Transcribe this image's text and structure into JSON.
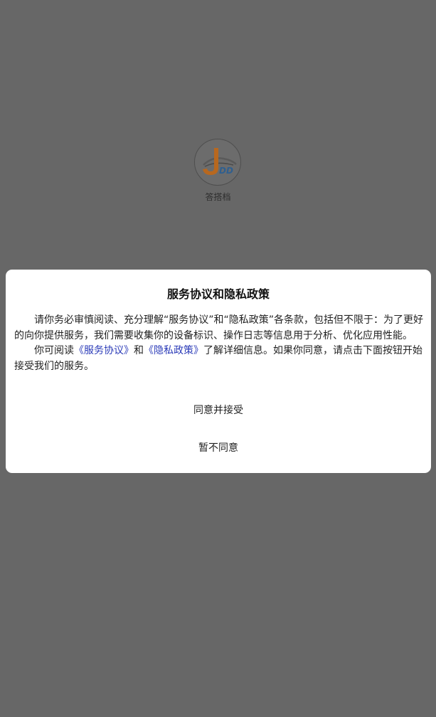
{
  "splash": {
    "app_name": "答搭档",
    "logo_text": "DD"
  },
  "dialog": {
    "title": "服务协议和隐私政策",
    "paragraph1": "请你务必审慎阅读、充分理解“服务协议”和“隐私政策”各条款，包括但不限于：为了更好的向你提供服务，我们需要收集你的设备标识、操作日志等信息用于分析、优化应用性能。",
    "paragraph2_prefix": "你可阅读",
    "terms_link": "《服务协议》",
    "and_text": "和",
    "privacy_link": "《隐私政策》",
    "paragraph2_suffix": "了解详细信息。如果你同意，请点击下面按钮开始接受我们的服务。",
    "accept_label": "同意并接受",
    "decline_label": "暂不同意"
  },
  "colors": {
    "overlay": "#676767",
    "link": "#2b3bb8",
    "logo_accent": "#b8681f"
  },
  "icons": {
    "logo": "jdd-car-logo"
  }
}
